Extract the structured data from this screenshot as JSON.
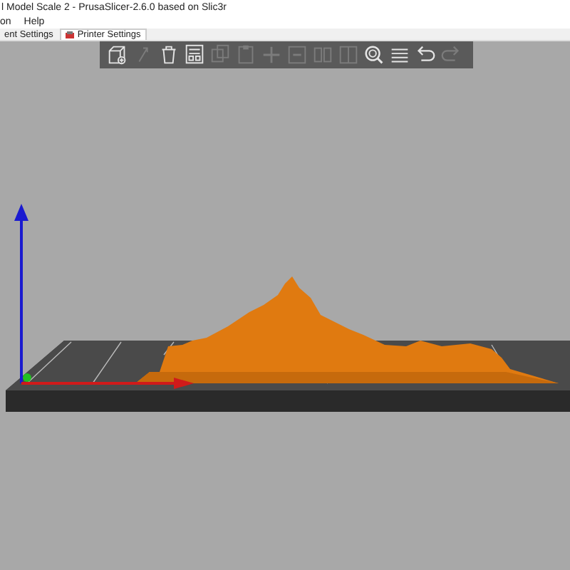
{
  "window": {
    "title": "l Model Scale 2 - PrusaSlicer-2.6.0 based on Slic3r"
  },
  "menu": [
    "on",
    "Help"
  ],
  "tabs": [
    {
      "label": "ent Settings",
      "selected": false,
      "kind": "plain"
    },
    {
      "label": "Printer Settings",
      "selected": true,
      "kind": "printer"
    }
  ],
  "toolbar": [
    {
      "kind": "add",
      "disabled": false
    },
    {
      "kind": "arrow",
      "disabled": true
    },
    {
      "kind": "delete",
      "disabled": false
    },
    {
      "kind": "arrange",
      "disabled": false
    },
    {
      "kind": "copy",
      "disabled": true
    },
    {
      "kind": "paste",
      "disabled": true
    },
    {
      "kind": "plus",
      "disabled": true
    },
    {
      "kind": "minus",
      "disabled": true
    },
    {
      "kind": "split",
      "disabled": true
    },
    {
      "kind": "split2",
      "disabled": true
    },
    {
      "kind": "search",
      "disabled": false
    },
    {
      "kind": "layers",
      "disabled": false
    },
    {
      "kind": "undo",
      "disabled": false
    },
    {
      "kind": "redo",
      "disabled": true
    }
  ]
}
